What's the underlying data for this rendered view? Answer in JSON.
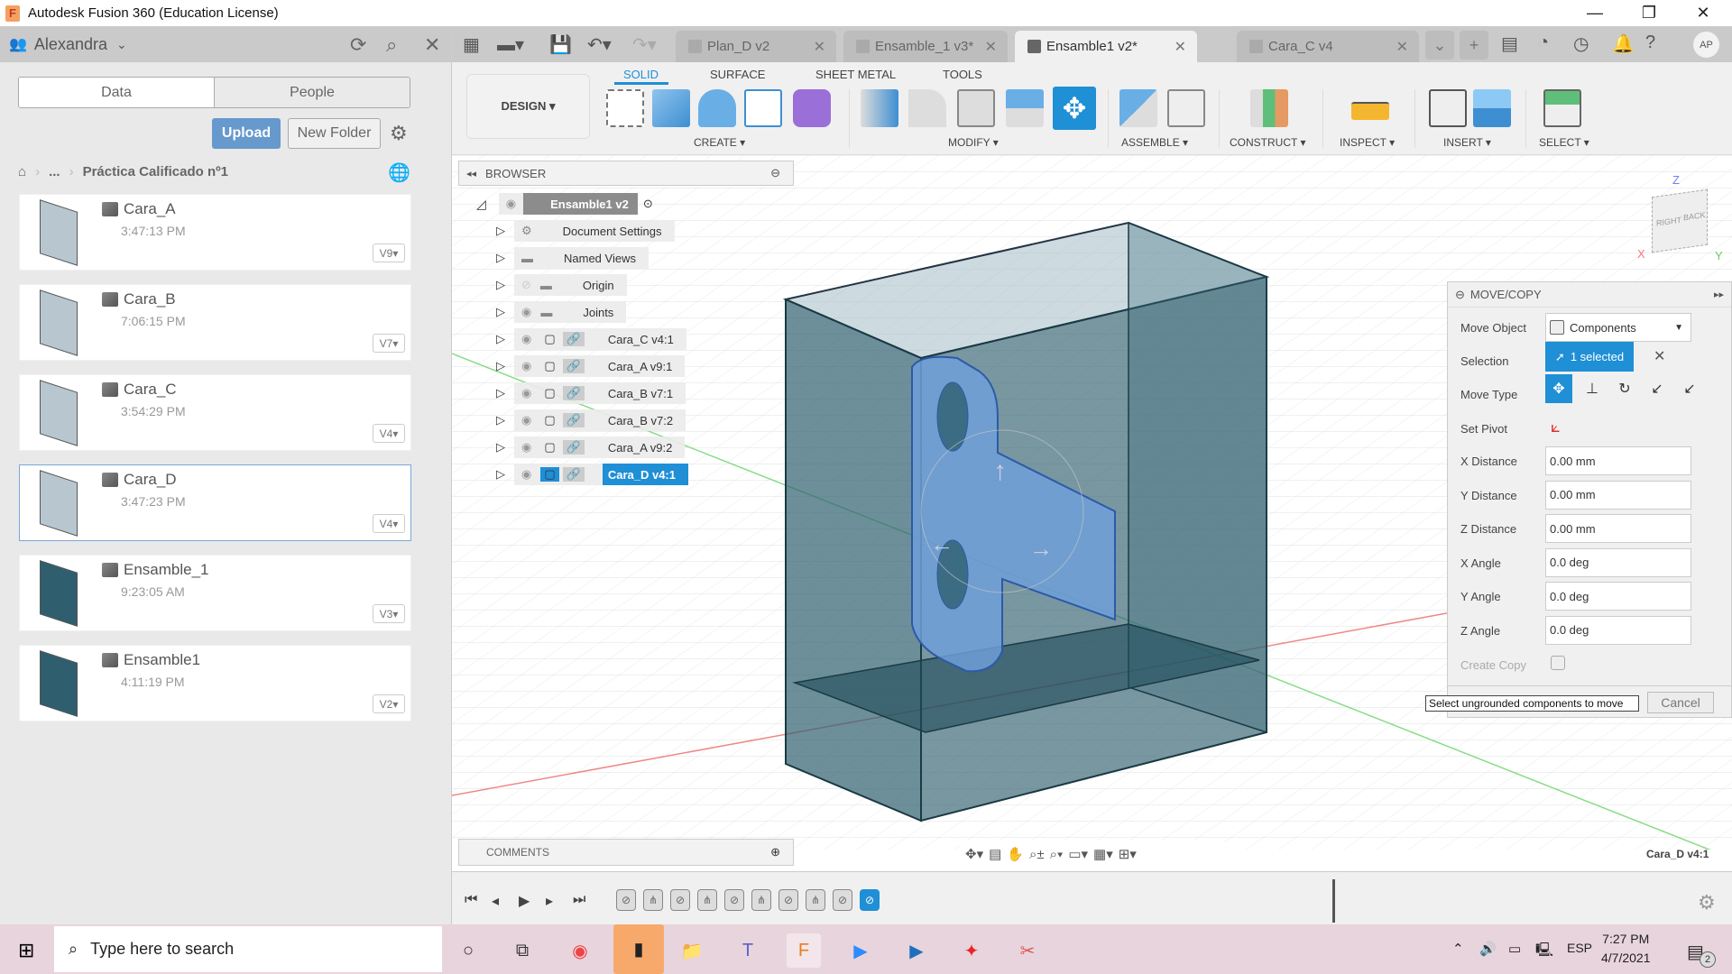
{
  "window": {
    "title": "Autodesk Fusion 360 (Education License)",
    "app_icon": "F",
    "controls": {
      "minimize": "—",
      "restore": "❐",
      "close": "✕"
    }
  },
  "data_panel": {
    "user": "Alexandra",
    "tabs": [
      {
        "label": "Data",
        "active": true
      },
      {
        "label": "People",
        "active": false
      }
    ],
    "upload_label": "Upload",
    "new_folder_label": "New Folder",
    "breadcrumb": {
      "ellipsis": "...",
      "folder": "Práctica Calificado nº1"
    },
    "files": [
      {
        "name": "Cara_A",
        "time": "3:47:13 PM",
        "version": "V9",
        "selected": false
      },
      {
        "name": "Cara_B",
        "time": "7:06:15 PM",
        "version": "V7",
        "selected": false
      },
      {
        "name": "Cara_C",
        "time": "3:54:29 PM",
        "version": "V4",
        "selected": false
      },
      {
        "name": "Cara_D",
        "time": "3:47:23 PM",
        "version": "V4",
        "selected": true
      },
      {
        "name": "Ensamble_1",
        "time": "9:23:05 AM",
        "version": "V3",
        "selected": false
      },
      {
        "name": "Ensamble1",
        "time": "4:11:19 PM",
        "version": "V2",
        "selected": false
      }
    ]
  },
  "doc_tabs": [
    {
      "label": "Plan_D v2",
      "active": false
    },
    {
      "label": "Ensamble_1 v3*",
      "active": false
    },
    {
      "label": "Ensamble1 v2*",
      "active": true
    },
    {
      "label": "Cara_C v4",
      "active": false
    }
  ],
  "user_initials": "AP",
  "toolbar": {
    "workspace": "DESIGN ▾",
    "tabs": [
      {
        "label": "SOLID",
        "active": true
      },
      {
        "label": "SURFACE",
        "active": false
      },
      {
        "label": "SHEET METAL",
        "active": false
      },
      {
        "label": "TOOLS",
        "active": false
      }
    ],
    "groups": [
      "CREATE ▾",
      "MODIFY ▾",
      "ASSEMBLE ▾",
      "CONSTRUCT ▾",
      "INSPECT ▾",
      "INSERT ▾",
      "SELECT ▾"
    ]
  },
  "browser": {
    "title": "BROWSER",
    "root": "Ensamble1 v2",
    "items": [
      {
        "label": "Document Settings",
        "type": "settings"
      },
      {
        "label": "Named Views",
        "type": "folder"
      },
      {
        "label": "Origin",
        "type": "folder-hidden"
      },
      {
        "label": "Joints",
        "type": "folder"
      },
      {
        "label": "Cara_C v4:1",
        "type": "component",
        "selected": false
      },
      {
        "label": "Cara_A v9:1",
        "type": "component",
        "selected": false
      },
      {
        "label": "Cara_B v7:1",
        "type": "component",
        "selected": false
      },
      {
        "label": "Cara_B v7:2",
        "type": "component",
        "selected": false
      },
      {
        "label": "Cara_A v9:2",
        "type": "component",
        "selected": false
      },
      {
        "label": "Cara_D v4:1",
        "type": "component",
        "selected": true
      }
    ]
  },
  "viewcube": {
    "top": "Z",
    "left_face": "RIGHT",
    "right_face": "BACK",
    "x": "X",
    "y": "Y"
  },
  "move_copy": {
    "title": "MOVE/COPY",
    "move_object_label": "Move Object",
    "move_object_value": "Components",
    "selection_label": "Selection",
    "selection_value": "1 selected",
    "move_type_label": "Move Type",
    "set_pivot_label": "Set Pivot",
    "fields": [
      {
        "label": "X Distance",
        "value": "0.00 mm"
      },
      {
        "label": "Y Distance",
        "value": "0.00 mm"
      },
      {
        "label": "Z Distance",
        "value": "0.00 mm"
      },
      {
        "label": "X Angle",
        "value": "0.0 deg"
      },
      {
        "label": "Y Angle",
        "value": "0.0 deg"
      },
      {
        "label": "Z Angle",
        "value": "0.0 deg"
      }
    ],
    "create_copy_label": "Create Copy",
    "create_copy_checked": false,
    "tooltip": "Select ungrounded components to move",
    "cancel_label": "Cancel"
  },
  "comments_label": "COMMENTS",
  "status_component": "Cara_D v4:1",
  "timeline": {
    "item_count": 10,
    "active_index": 9
  },
  "taskbar": {
    "search_placeholder": "Type here to search",
    "language": "ESP",
    "time": "7:27 PM",
    "date": "4/7/2021",
    "notifications": "2"
  },
  "colors": {
    "accent": "#1f8fd6",
    "upload": "#6699cc",
    "model": "#2f5f6f",
    "selection": "#6f9fd8"
  }
}
